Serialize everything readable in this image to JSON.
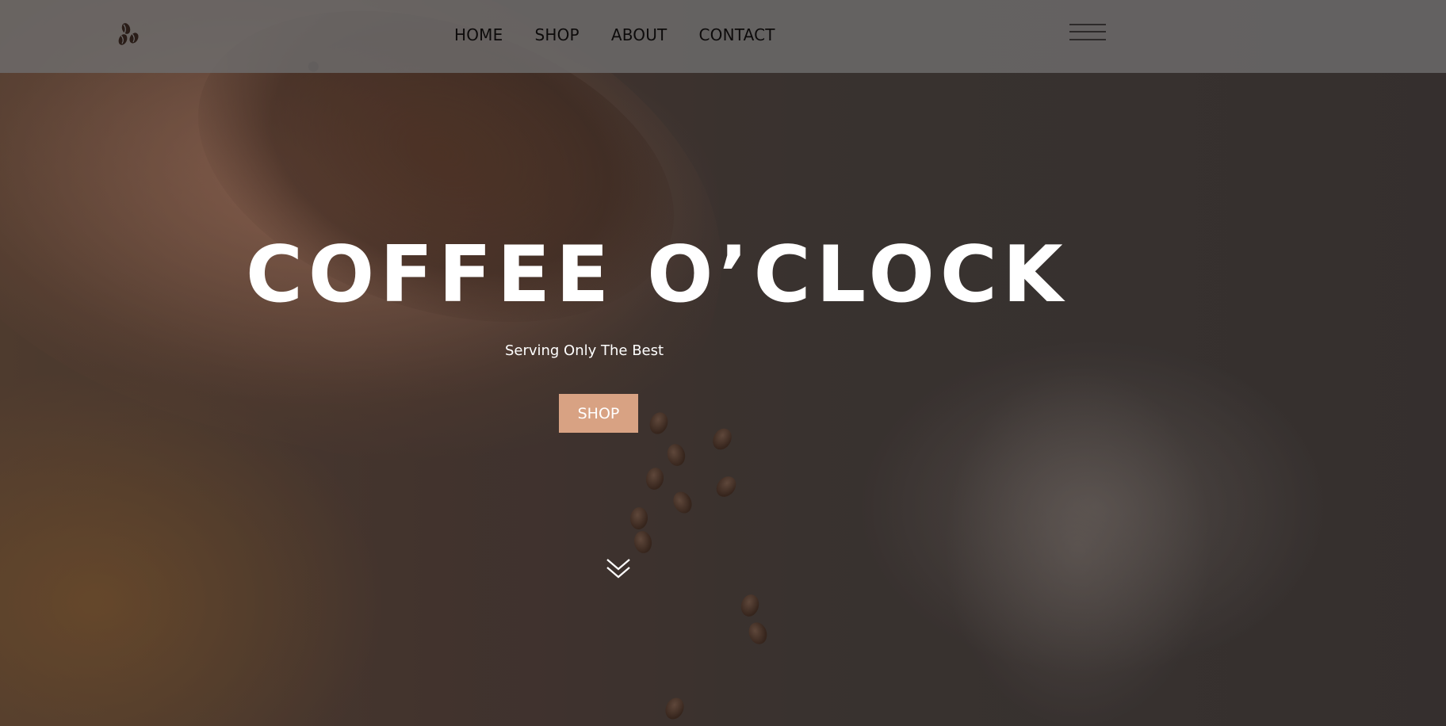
{
  "nav": {
    "logo_icon": "coffee-beans-icon",
    "links": [
      {
        "label": "HOME"
      },
      {
        "label": "SHOP"
      },
      {
        "label": "ABOUT"
      },
      {
        "label": "CONTACT"
      }
    ],
    "menu_icon": "hamburger-menu-icon"
  },
  "hero": {
    "title": "COFFEE O’CLOCK",
    "subtitle": "Serving Only The Best",
    "cta_label": "SHOP",
    "scroll_icon": "double-chevron-down-icon"
  },
  "colors": {
    "navbar_bg": "#6e6c6c",
    "nav_text": "#0d0b0b",
    "cta_bg": "#d8a283",
    "hero_text": "#ffffff"
  }
}
